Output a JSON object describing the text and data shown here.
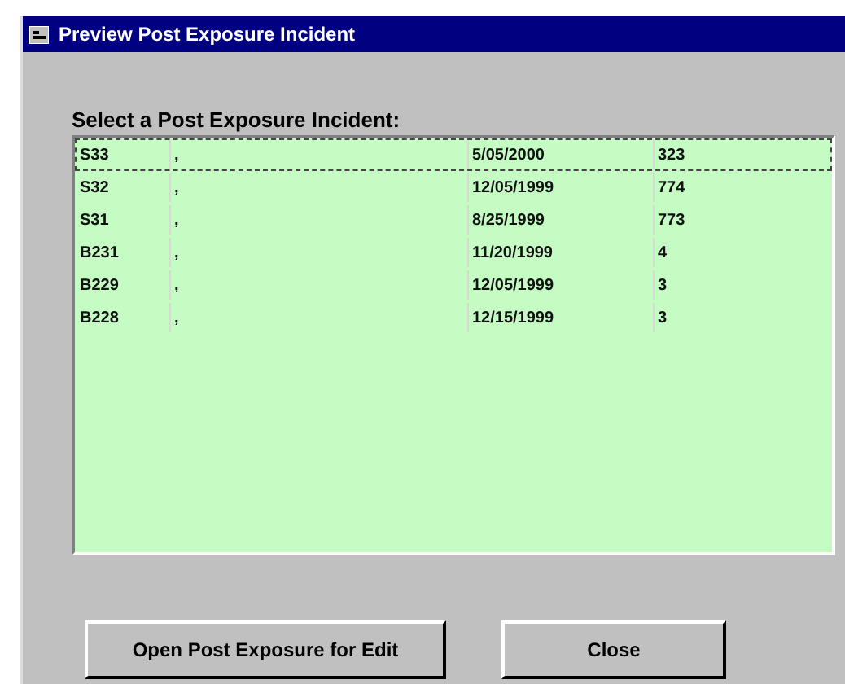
{
  "window": {
    "title": "Preview Post Exposure Incident"
  },
  "list": {
    "label": "Select a Post Exposure Incident:",
    "rows": [
      {
        "cells": [
          "S33",
          ",",
          "5/05/2000",
          "323"
        ],
        "selected": true
      },
      {
        "cells": [
          "S32",
          ",",
          "12/05/1999",
          "774"
        ],
        "selected": false
      },
      {
        "cells": [
          "S31",
          ",",
          "8/25/1999",
          "773"
        ],
        "selected": false
      },
      {
        "cells": [
          "B231",
          ",",
          "11/20/1999",
          "4"
        ],
        "selected": false
      },
      {
        "cells": [
          "B229",
          ",",
          "12/05/1999",
          "3"
        ],
        "selected": false
      },
      {
        "cells": [
          "B228",
          ",",
          "12/15/1999",
          "3"
        ],
        "selected": false
      }
    ]
  },
  "buttons": [
    "Open Post Exposure for Edit",
    "Close"
  ]
}
